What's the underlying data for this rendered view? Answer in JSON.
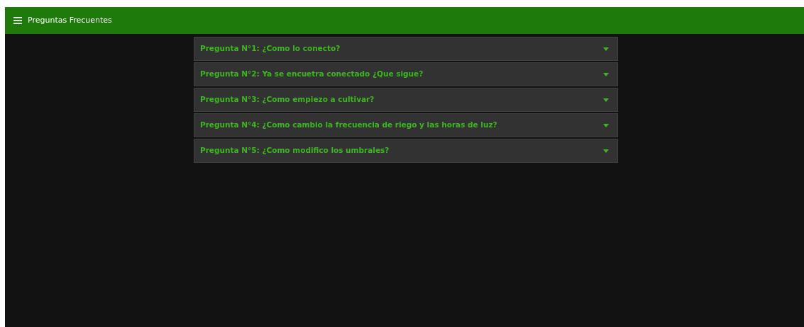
{
  "app_bar": {
    "title": "Preguntas Frecuentes"
  },
  "questions": [
    {
      "label": "Pregunta N°1: ¿Como lo conecto?",
      "expanded": false
    },
    {
      "label": "Pregunta N°2: Ya se encuetra conectado ¿Que sigue?",
      "expanded": false
    },
    {
      "label": "Pregunta N°3: ¿Como empiezo a cultivar?",
      "expanded": false
    },
    {
      "label": "Pregunta N°4: ¿Como cambio la frecuencia de riego y las horas de luz?",
      "expanded": false
    },
    {
      "label": "Pregunta N°5: ¿Como modifico los umbrales?",
      "expanded": false
    }
  ]
}
